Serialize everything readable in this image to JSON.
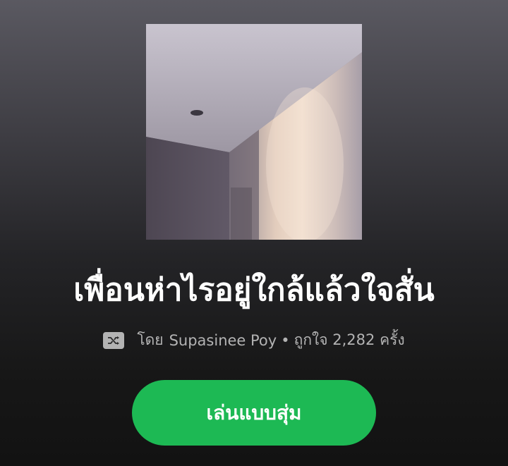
{
  "playlist": {
    "title": "เพื่อนห่าไรอยู่ใกล้แล้วใจสั่น",
    "by_label": "โดย",
    "owner": "Supasinee Poy",
    "separator": "•",
    "likes_text": "ถูกใจ 2,282 ครั้ง",
    "cover_icon": "shuffle-icon"
  },
  "actions": {
    "shuffle_play_label": "เล่นแบบสุ่ม"
  },
  "colors": {
    "accent": "#1db954",
    "title_text": "#ffffff",
    "meta_text": "#b3b3b3"
  }
}
